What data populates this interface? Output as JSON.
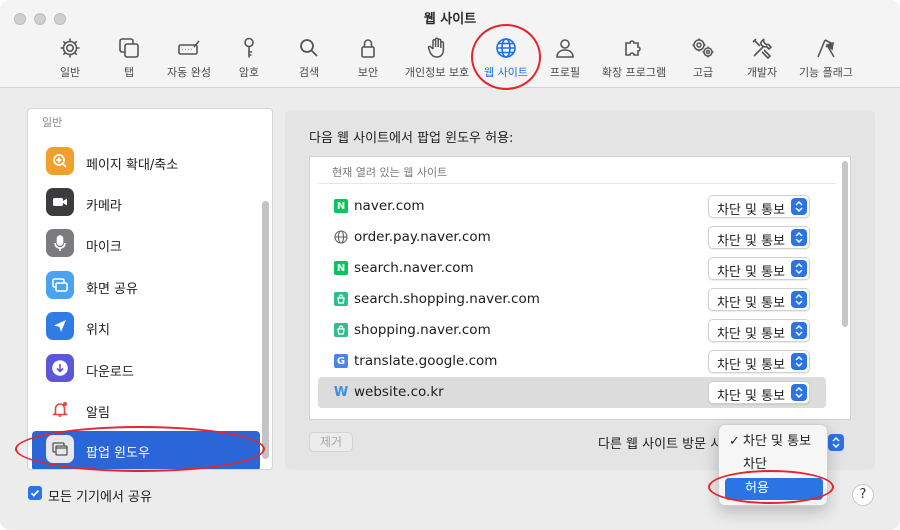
{
  "window": {
    "title": "웹 사이트"
  },
  "toolbar": {
    "items": [
      {
        "label": "일반",
        "icon": "gear-icon"
      },
      {
        "label": "탭",
        "icon": "tabs-icon"
      },
      {
        "label": "자동 완성",
        "icon": "autofill-icon"
      },
      {
        "label": "암호",
        "icon": "key-icon"
      },
      {
        "label": "검색",
        "icon": "search-icon"
      },
      {
        "label": "보안",
        "icon": "lock-icon"
      },
      {
        "label": "개인정보 보호",
        "icon": "hand-icon"
      },
      {
        "label": "웹 사이트",
        "icon": "globe-icon",
        "active": true
      },
      {
        "label": "프로필",
        "icon": "person-icon"
      },
      {
        "label": "확장 프로그램",
        "icon": "puzzle-icon"
      },
      {
        "label": "고급",
        "icon": "gears-icon"
      },
      {
        "label": "개발자",
        "icon": "tools-icon"
      },
      {
        "label": "기능 플래그",
        "icon": "flags-icon"
      }
    ]
  },
  "sidebar": {
    "header": "일반",
    "items": [
      {
        "label": "페이지 확대/축소",
        "icon": "zoom-icon"
      },
      {
        "label": "카메라",
        "icon": "camera-icon"
      },
      {
        "label": "마이크",
        "icon": "microphone-icon"
      },
      {
        "label": "화면 공유",
        "icon": "screen-share-icon"
      },
      {
        "label": "위치",
        "icon": "location-icon"
      },
      {
        "label": "다운로드",
        "icon": "download-icon"
      },
      {
        "label": "알림",
        "icon": "bell-icon"
      },
      {
        "label": "팝업 윈도우",
        "icon": "popup-window-icon",
        "selected": true
      }
    ],
    "share_label": "모든 기기에서 공유",
    "share_checked": true
  },
  "main": {
    "title": "다음 웹 사이트에서 팝업 윈도우 허용:",
    "list_header": "현재 열려 있는 웹 사이트",
    "sites": [
      {
        "domain": "naver.com",
        "favicon": "naver-favicon",
        "setting": "차단 및 통보"
      },
      {
        "domain": "order.pay.naver.com",
        "favicon": "globe-favicon",
        "setting": "차단 및 통보"
      },
      {
        "domain": "search.naver.com",
        "favicon": "naver-favicon",
        "setting": "차단 및 통보"
      },
      {
        "domain": "search.shopping.naver.com",
        "favicon": "naver-shopping-favicon",
        "setting": "차단 및 통보"
      },
      {
        "domain": "shopping.naver.com",
        "favicon": "naver-shopping-favicon",
        "setting": "차단 및 통보"
      },
      {
        "domain": "translate.google.com",
        "favicon": "google-translate-favicon",
        "setting": "차단 및 통보"
      },
      {
        "domain": "website.co.kr",
        "favicon": "w-favicon",
        "setting": "차단 및 통보",
        "highlighted": true
      }
    ],
    "remove_label": "제거",
    "other_sites_label": "다른 웹 사이트 방문 시",
    "dropdown": {
      "options": [
        {
          "label": "차단 및 통보",
          "checked": true
        },
        {
          "label": "차단"
        },
        {
          "label": "허용",
          "highlighted": true
        }
      ]
    },
    "help_label": "?"
  },
  "colors": {
    "accent": "#2b74e6",
    "sidebar_selected": "#2b66d9",
    "annotation_ring": "#e3262c",
    "naver_green": "#03c75a"
  }
}
